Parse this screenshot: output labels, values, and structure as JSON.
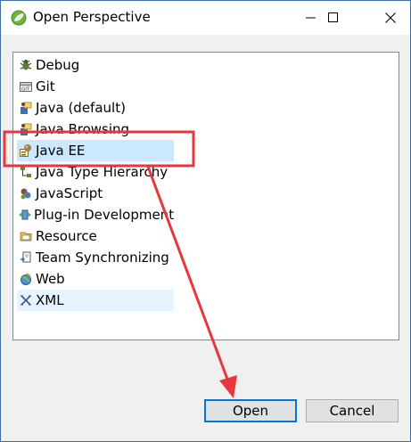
{
  "window": {
    "title": "Open Perspective"
  },
  "perspectives": [
    {
      "label": "Debug",
      "icon": "debug-icon"
    },
    {
      "label": "Git",
      "icon": "git-icon"
    },
    {
      "label": "Java (default)",
      "icon": "java-icon"
    },
    {
      "label": "Java Browsing",
      "icon": "java-browsing-icon"
    },
    {
      "label": "Java EE",
      "icon": "java-ee-icon",
      "selected": true
    },
    {
      "label": "Java Type Hierarchy",
      "icon": "type-hierarchy-icon"
    },
    {
      "label": "JavaScript",
      "icon": "javascript-icon"
    },
    {
      "label": "Plug-in Development",
      "icon": "plugin-icon"
    },
    {
      "label": "Resource",
      "icon": "resource-icon"
    },
    {
      "label": "Team Synchronizing",
      "icon": "team-sync-icon"
    },
    {
      "label": "Web",
      "icon": "web-icon"
    },
    {
      "label": "XML",
      "icon": "xml-icon",
      "hover": true
    }
  ],
  "buttons": {
    "open": "Open",
    "cancel": "Cancel"
  },
  "colors": {
    "selection": "#cce8ff",
    "hover": "#e5f3ff",
    "annotation": "#e8373c",
    "default_button_border": "#0078d7"
  }
}
